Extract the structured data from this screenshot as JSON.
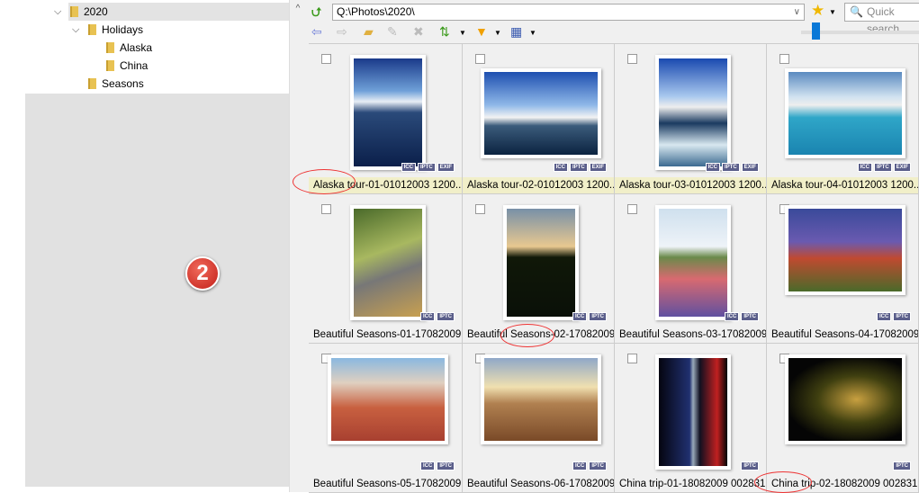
{
  "tree": [
    {
      "label": "2020",
      "level": 0,
      "expanded": true
    },
    {
      "label": "Holidays",
      "level": 1,
      "expanded": true
    },
    {
      "label": "Alaska",
      "level": 2
    },
    {
      "label": "China",
      "level": 2
    },
    {
      "label": "Seasons",
      "level": 1
    }
  ],
  "badge": "2",
  "toolbar": {
    "address": "Q:\\Photos\\2020\\",
    "search_placeholder": "Quick search"
  },
  "tiles": [
    {
      "caption": "Alaska tour-01-01012003 1200...",
      "tags": [
        "ICC",
        "IPTC",
        "EXIF"
      ],
      "bg": "linear-gradient(#1a3a8a,#6fa0d8 30%,#e8eef5 40%,#2a4a7a 50%,#0b1f4a)",
      "orient": "p"
    },
    {
      "caption": "Alaska tour-02-01012003 1200...",
      "tags": [
        "ICC",
        "IPTC",
        "EXIF"
      ],
      "bg": "linear-gradient(#1e4fb0,#8fb8e8 40%,#f3f3f3 55%,#3b5b7b 65%,#0b2340)",
      "orient": "l"
    },
    {
      "caption": "Alaska tour-03-01012003 1200...",
      "tags": [
        "ICC",
        "IPTC",
        "EXIF"
      ],
      "bg": "linear-gradient(#1a4ab0,#a8c8ee 35%,#eee 45%,#1a3a60 60%,#d8e8f0 80%,#3b6a90)",
      "orient": "p"
    },
    {
      "caption": "Alaska tour-04-01012003 1200...",
      "tags": [
        "ICC",
        "IPTC",
        "EXIF"
      ],
      "bg": "linear-gradient(#5a8ac0,#d0e2f0 30%,#eee 40%,#2fa6c8 55%,#1a84b0)",
      "orient": "l"
    },
    {
      "caption": "Beautiful Seasons-01-17082009...",
      "tags": [
        "ICC",
        "IPTC"
      ],
      "bg": "linear-gradient(160deg,#4a6a2a,#a8b860 40%,#777 60%,#c8a050)",
      "orient": "p"
    },
    {
      "caption": "Beautiful Seasons-02-17082009...",
      "tags": [
        "ICC",
        "IPTC"
      ],
      "bg": "linear-gradient(#7890a8,#e8c890 35%,#101808 45%,#0a1008)",
      "orient": "p"
    },
    {
      "caption": "Beautiful Seasons-03-17082009...",
      "tags": [
        "ICC",
        "IPTC"
      ],
      "bg": "linear-gradient(#cfe0ee,#eef3f8 35%,#6a8a4a 45%,#d86a70 65%,#6050a0)",
      "orient": "p"
    },
    {
      "caption": "Beautiful Seasons-04-17082009...",
      "tags": [
        "ICC",
        "IPTC"
      ],
      "bg": "linear-gradient(#3a4a9a,#6a5ab0 40%,#c04a30 60%,#4a6a2a)",
      "orient": "l"
    },
    {
      "caption": "Beautiful Seasons-05-17082009...",
      "tags": [
        "ICC",
        "IPTC"
      ],
      "bg": "linear-gradient(#8ab8e0,#e0d0c0 30%,#c86040 60%,#a84030)",
      "orient": "l"
    },
    {
      "caption": "Beautiful Seasons-06-17082009...",
      "tags": [
        "ICC",
        "IPTC"
      ],
      "bg": "linear-gradient(#90a8c8,#f0e0b0 35%,#b08050 55%,#7a4a28)",
      "orient": "l"
    },
    {
      "caption": "China trip-01-18082009 002831...",
      "tags": [
        "IPTC"
      ],
      "bg": "linear-gradient(90deg,#050510,#203070 45%,#9ab 50%,#101020 60%,#c02020 85%,#050505)",
      "orient": "p"
    },
    {
      "caption": "China trip-02-18082009 002831...",
      "tags": [
        "IPTC"
      ],
      "bg": "radial-gradient(ellipse at 60% 50%,#c8a040,#404010 40%,#050505 75%)",
      "orient": "l"
    }
  ]
}
